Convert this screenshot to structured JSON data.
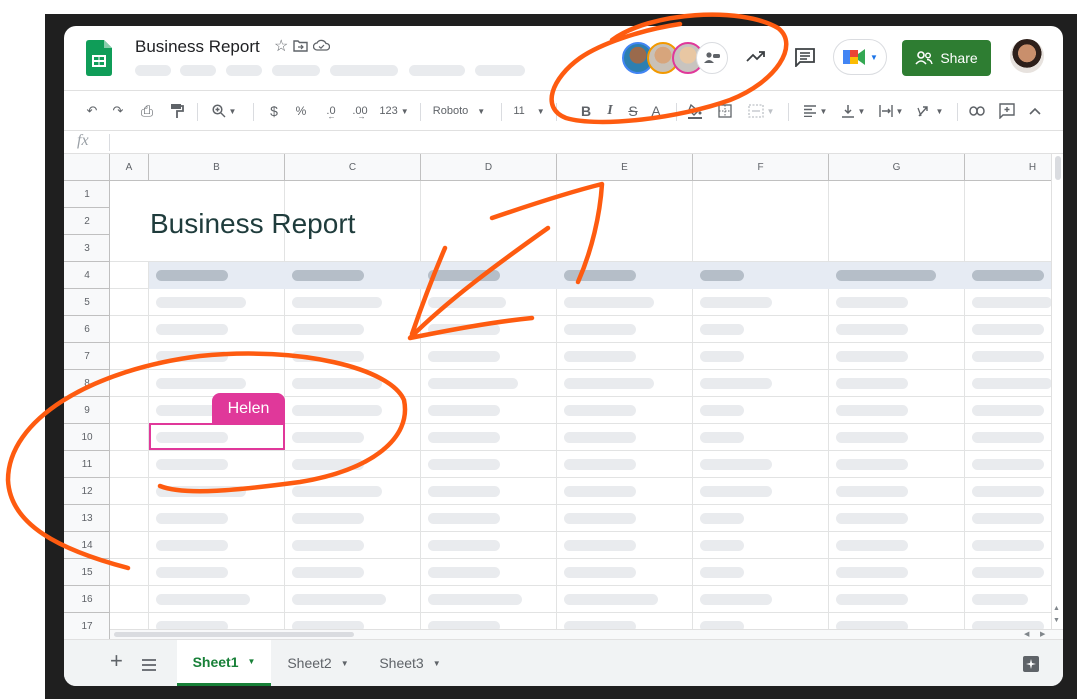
{
  "document": {
    "title": "Business Report",
    "sheet_heading": "Business Report"
  },
  "header": {
    "share_label": "Share"
  },
  "toolbar": {
    "font": "Roboto",
    "font_size": "11",
    "format_123": "123",
    "currency": "$",
    "percent": "%",
    "dec_less": ".0",
    "dec_more": ".00",
    "fx": "fx"
  },
  "columns": [
    "A",
    "B",
    "C",
    "D",
    "E",
    "F",
    "G",
    "H"
  ],
  "rows": [
    "1",
    "2",
    "3",
    "4",
    "5",
    "6",
    "7",
    "8",
    "9",
    "10",
    "11",
    "12",
    "13",
    "14",
    "15",
    "16",
    "17"
  ],
  "collaborator": {
    "name": "Helen",
    "color": "#e0389a"
  },
  "sheets": [
    {
      "label": "Sheet1",
      "active": true
    },
    {
      "label": "Sheet2",
      "active": false
    },
    {
      "label": "Sheet3",
      "active": false
    }
  ],
  "colors": {
    "brand_green": "#188038",
    "annotation_orange": "#fe5b10"
  }
}
